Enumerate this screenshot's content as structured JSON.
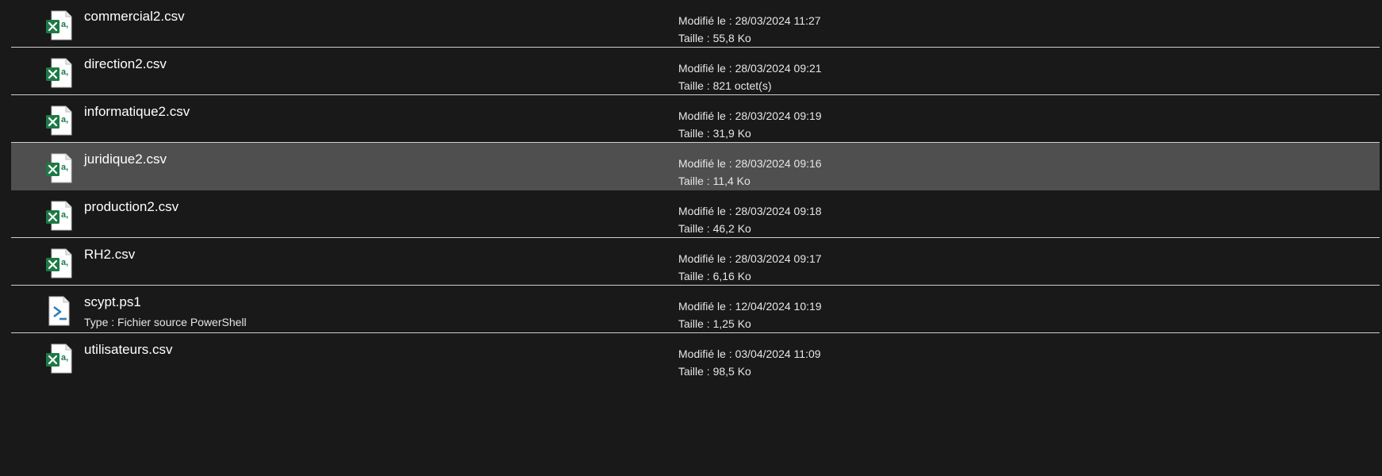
{
  "files": [
    {
      "name": "commercial2.csv",
      "icon": "excel-csv-icon",
      "modified": "Modifié le : 28/03/2024 11:27",
      "size": "Taille : 55,8 Ko"
    },
    {
      "name": "direction2.csv",
      "icon": "excel-csv-icon",
      "modified": "Modifié le : 28/03/2024 09:21",
      "size": "Taille : 821 octet(s)"
    },
    {
      "name": "informatique2.csv",
      "icon": "excel-csv-icon",
      "modified": "Modifié le : 28/03/2024 09:19",
      "size": "Taille : 31,9 Ko"
    },
    {
      "name": "juridique2.csv",
      "icon": "excel-csv-icon",
      "modified": "Modifié le : 28/03/2024 09:16",
      "size": "Taille : 11,4 Ko",
      "selected": true
    },
    {
      "name": "production2.csv",
      "icon": "excel-csv-icon",
      "modified": "Modifié le : 28/03/2024 09:18",
      "size": "Taille : 46,2 Ko"
    },
    {
      "name": "RH2.csv",
      "icon": "excel-csv-icon",
      "modified": "Modifié le : 28/03/2024 09:17",
      "size": "Taille : 6,16 Ko"
    },
    {
      "name": "scypt.ps1",
      "icon": "powershell-script-icon",
      "type": "Type : Fichier source PowerShell",
      "modified": "Modifié le : 12/04/2024 10:19",
      "size": "Taille : 1,25 Ko"
    },
    {
      "name": "utilisateurs.csv",
      "icon": "excel-csv-icon",
      "modified": "Modifié le : 03/04/2024 11:09",
      "size": "Taille : 98,5 Ko"
    }
  ],
  "colors": {
    "background": "#191919",
    "selected_row": "#4f4f4f",
    "separator": "#cfcfcf",
    "excel_green": "#1d7a45",
    "powershell_blue": "#2c7fb8"
  }
}
